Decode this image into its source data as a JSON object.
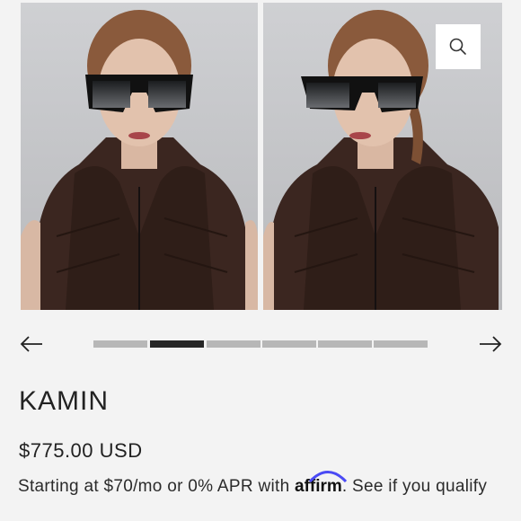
{
  "gallery": {
    "images": [
      {
        "alt": "Model wearing KAMIN sunglasses, front view"
      },
      {
        "alt": "Model wearing KAMIN sunglasses, angled view"
      }
    ],
    "zoom_icon": "search-icon",
    "prev_icon": "arrow-left-icon",
    "next_icon": "arrow-right-icon",
    "slide_count": 6,
    "active_slide": 2
  },
  "product": {
    "title": "KAMIN",
    "price": "$775.00 USD"
  },
  "financing": {
    "prefix": "Starting at $70/mo or 0% APR with",
    "brand": "affirm",
    "suffix": ".",
    "link": "See if you qualify"
  },
  "colors": {
    "background": "#f3f3f3",
    "active_dot": "#272727",
    "inactive_dot": "#b7b7b7",
    "affirm_arc": "#4a4af4"
  }
}
